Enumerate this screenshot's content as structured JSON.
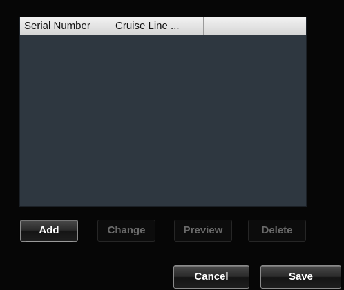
{
  "list": {
    "columns": [
      "Serial Number",
      "Cruise Line ...",
      ""
    ],
    "rows": []
  },
  "actions": {
    "add_label": "Add",
    "change_label": "Change",
    "preview_label": "Preview",
    "delete_label": "Delete"
  },
  "footer": {
    "cancel_label": "Cancel",
    "save_label": "Save"
  },
  "colors": {
    "background": "#060606",
    "list_background": "#2e3740",
    "header_background": "#e6e6e6",
    "disabled_text": "#6a6a6a"
  }
}
